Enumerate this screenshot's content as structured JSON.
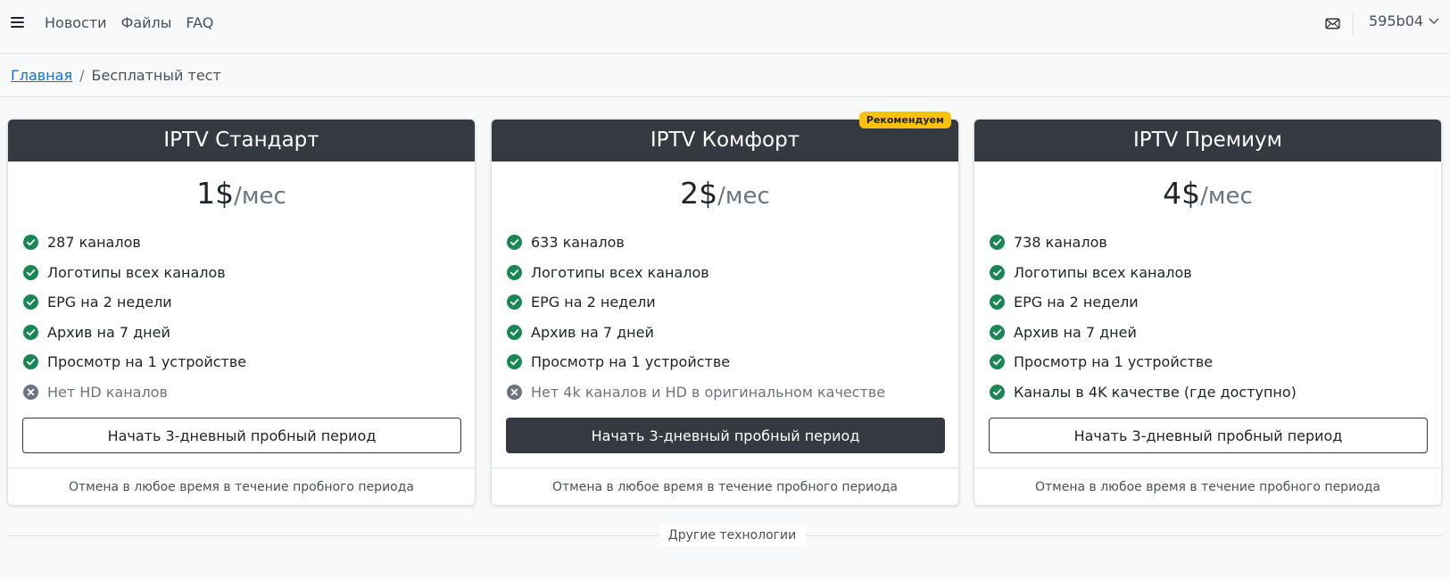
{
  "nav": {
    "links": [
      "Новости",
      "Файлы",
      "FAQ"
    ],
    "user": "595b04"
  },
  "breadcrumb": {
    "home": "Главная",
    "current": "Бесплатный тест"
  },
  "plans": [
    {
      "title": "IPTV Стандарт",
      "price": "1$",
      "period": "/мес",
      "features": [
        {
          "text": "287 каналов",
          "included": true
        },
        {
          "text": "Логотипы всех каналов",
          "included": true
        },
        {
          "text": "EPG на 2 недели",
          "included": true
        },
        {
          "text": "Архив на 7 дней",
          "included": true
        },
        {
          "text": "Просмотр на 1 устройстве",
          "included": true
        },
        {
          "text": "Нет HD каналов",
          "included": false
        }
      ],
      "button": "Начать 3-дневный пробный период",
      "footer": "Отмена в любое время в течение пробного периода"
    },
    {
      "title": "IPTV Комфорт",
      "badge": "Рекомендуем",
      "price": "2$",
      "period": "/мес",
      "features": [
        {
          "text": "633 каналов",
          "included": true
        },
        {
          "text": "Логотипы всех каналов",
          "included": true
        },
        {
          "text": "EPG на 2 недели",
          "included": true
        },
        {
          "text": "Архив на 7 дней",
          "included": true
        },
        {
          "text": "Просмотр на 1 устройстве",
          "included": true
        },
        {
          "text": "Нет 4k каналов и HD в оригинальном качестве",
          "included": false
        }
      ],
      "button": "Начать 3-дневный пробный период",
      "footer": "Отмена в любое время в течение пробного периода"
    },
    {
      "title": "IPTV Премиум",
      "price": "4$",
      "period": "/мес",
      "features": [
        {
          "text": "738 каналов",
          "included": true
        },
        {
          "text": "Логотипы всех каналов",
          "included": true
        },
        {
          "text": "EPG на 2 недели",
          "included": true
        },
        {
          "text": "Архив на 7 дней",
          "included": true
        },
        {
          "text": "Просмотр на 1 устройстве",
          "included": true
        },
        {
          "text": "Каналы в 4K качестве (где доступно)",
          "included": true
        }
      ],
      "button": "Начать 3-дневный пробный период",
      "footer": "Отмена в любое время в течение пробного периода"
    }
  ],
  "divider_label": "Другие технологии",
  "colors": {
    "header_dark": "#343a40",
    "check_green": "#198754",
    "cross_gray": "#6c757d",
    "badge_yellow": "#ffc107",
    "link_blue": "#0d6efd"
  },
  "icons": {
    "menu": "hamburger-icon",
    "mail": "envelope-icon",
    "user_dropdown": "chevron-down-icon",
    "included": "check-circle-icon",
    "excluded": "x-circle-icon"
  }
}
